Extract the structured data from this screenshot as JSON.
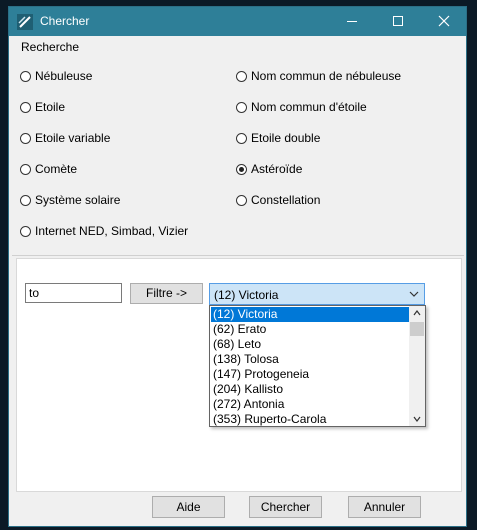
{
  "window": {
    "title": "Chercher",
    "icon": "telescope-icon"
  },
  "titlebar_controls": {
    "minimize": "minimize-icon",
    "maximize": "maximize-icon",
    "close": "close-icon"
  },
  "search_group": {
    "label": "Recherche",
    "options": [
      {
        "label": "Nébuleuse",
        "checked": false
      },
      {
        "label": "Nom commun de nébuleuse",
        "checked": false
      },
      {
        "label": "Etoile",
        "checked": false
      },
      {
        "label": "Nom commun d'étoile",
        "checked": false
      },
      {
        "label": "Etoile variable",
        "checked": false
      },
      {
        "label": "Etoile double",
        "checked": false
      },
      {
        "label": "Comète",
        "checked": false
      },
      {
        "label": "Astéroïde",
        "checked": true
      },
      {
        "label": "Système solaire",
        "checked": false
      },
      {
        "label": "Constellation",
        "checked": false
      },
      {
        "label": "Internet NED, Simbad, Vizier",
        "checked": false
      }
    ]
  },
  "filter": {
    "input_value": "to",
    "button_label": "Filtre ->"
  },
  "combo": {
    "selected": "(12) Victoria",
    "items": [
      "(12) Victoria",
      "(62) Erato",
      "(68) Leto",
      "(138) Tolosa",
      "(147) Protogeneia",
      "(204) Kallisto",
      "(272) Antonia",
      "(353) Ruperto-Carola"
    ],
    "selected_index": 0
  },
  "buttons": {
    "help": "Aide",
    "search": "Chercher",
    "cancel": "Annuler"
  },
  "colors": {
    "titlebar": "#2e7f98",
    "selection": "#0078d7",
    "combo_focus": "#cce4f7"
  }
}
